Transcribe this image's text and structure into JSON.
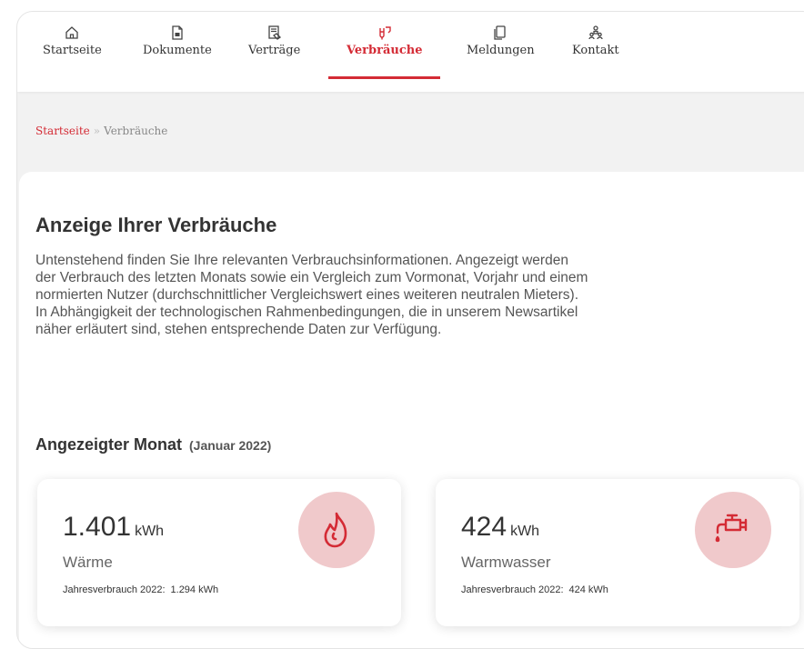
{
  "nav": {
    "items": [
      {
        "label": "Startseite",
        "icon": "home-icon",
        "active": false
      },
      {
        "label": "Dokumente",
        "icon": "pdf-document-icon",
        "active": false
      },
      {
        "label": "Verträge",
        "icon": "contract-icon",
        "active": false
      },
      {
        "label": "Verbräuche",
        "icon": "consumption-icon",
        "active": true
      },
      {
        "label": "Meldungen",
        "icon": "messages-icon",
        "active": false
      },
      {
        "label": "Kontakt",
        "icon": "contact-icon",
        "active": false
      }
    ]
  },
  "breadcrumb": {
    "home": "Startseite",
    "separator": "»",
    "current": "Verbräuche"
  },
  "main": {
    "title": "Anzeige Ihrer Verbräuche",
    "intro": "Untenstehend finden Sie Ihre relevanten Verbrauchsinformationen. Angezeigt werden der Verbrauch des letzten Monats sowie ein Vergleich zum Vormonat, Vorjahr und einem normierten Nutzer (durchschnittlicher Vergleichswert eines weiteren neutralen Mieters). In Abhängigkeit der technologischen Rahmenbedingungen, die in unserem Newsartikel näher erläutert sind, stehen entsprechende Daten zur Verfügung.",
    "month_heading": "Angezeigter Monat",
    "month": "(Januar 2022)"
  },
  "cards": [
    {
      "value": "1.401",
      "unit": "kWh",
      "label": "Wärme",
      "annual_label": "Jahresverbrauch 2022:",
      "annual_value": "1.294 kWh",
      "icon": "flame-icon"
    },
    {
      "value": "424",
      "unit": "kWh",
      "label": "Warmwasser",
      "annual_label": "Jahresverbrauch 2022:",
      "annual_value": "424 kWh",
      "icon": "faucet-icon"
    }
  ],
  "colors": {
    "accent": "#d42b35",
    "icon_circle": "#f0c9cb",
    "background": "#f2f2f2"
  }
}
